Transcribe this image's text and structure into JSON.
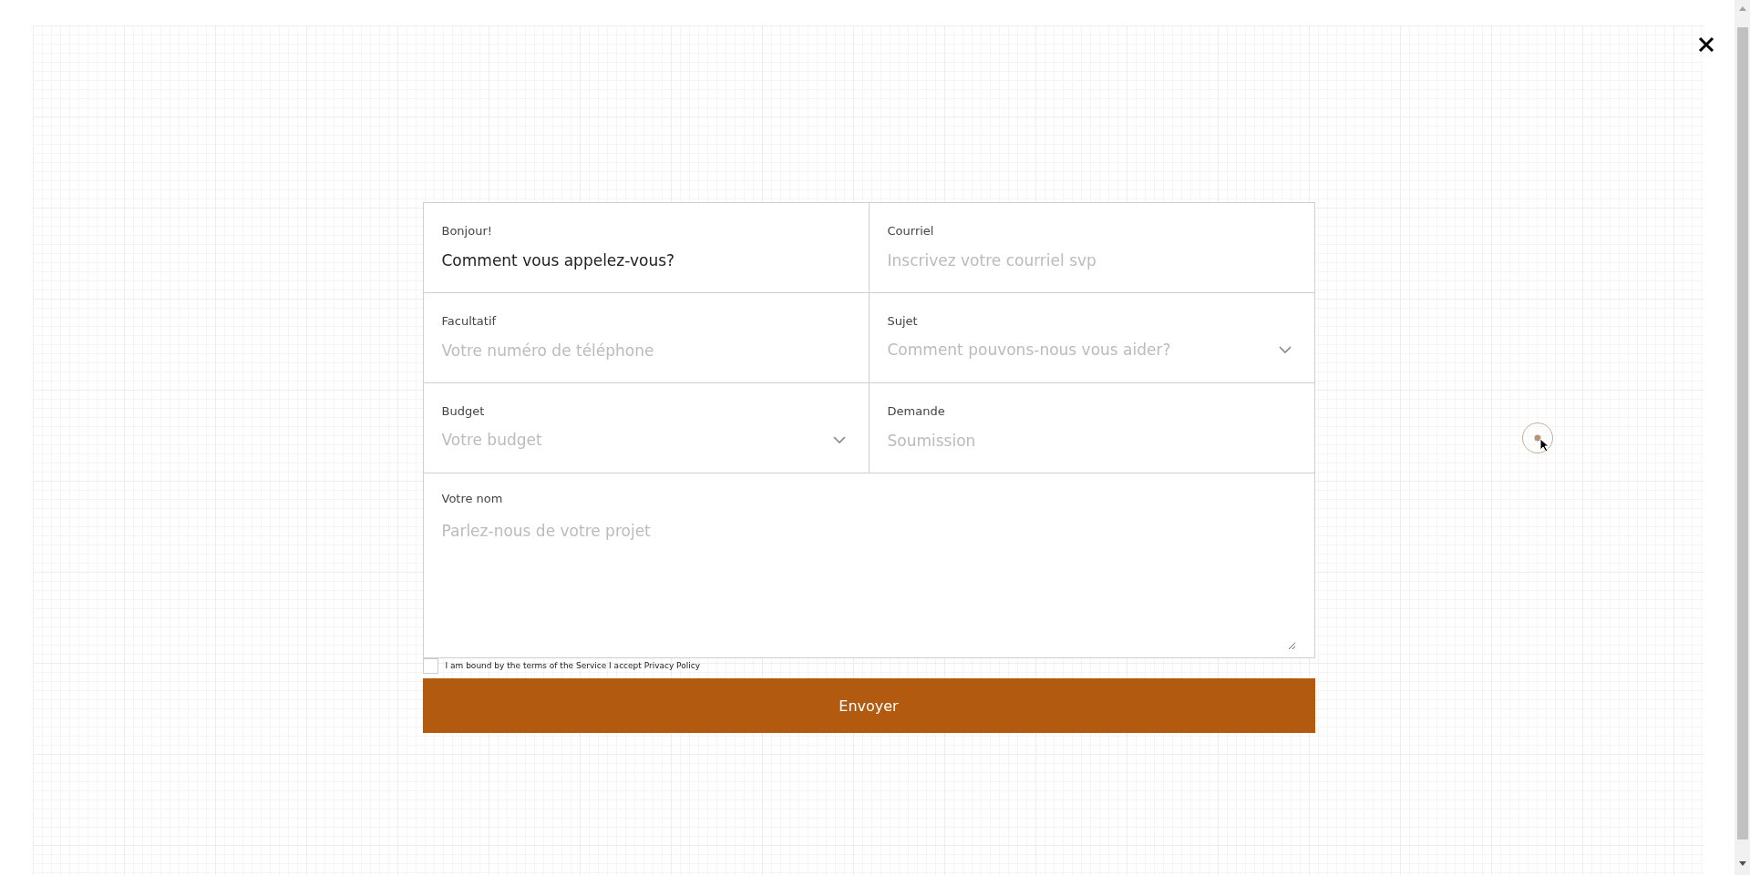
{
  "form": {
    "fields": [
      {
        "kind": "text",
        "label": "Bonjour!",
        "value": "Comment vous appelez-vous?"
      },
      {
        "kind": "text",
        "label": "Courriel",
        "placeholder": "Inscrivez votre courriel svp"
      },
      {
        "kind": "text",
        "label": "Facultatif",
        "placeholder": "Votre numéro de téléphone"
      },
      {
        "kind": "select",
        "label": "Sujet",
        "placeholder": "Comment pouvons-nous vous aider?"
      },
      {
        "kind": "select",
        "label": "Budget",
        "placeholder": "Votre budget"
      },
      {
        "kind": "text",
        "label": "Demande",
        "placeholder": "Soumission"
      },
      {
        "kind": "textarea",
        "label": "Votre nom",
        "placeholder": "Parlez-nous de votre projet"
      }
    ],
    "consent": {
      "label": "I am bound by the terms of the Service I accept Privacy Policy",
      "checked": false
    },
    "submit": {
      "label": "Envoyer"
    }
  }
}
